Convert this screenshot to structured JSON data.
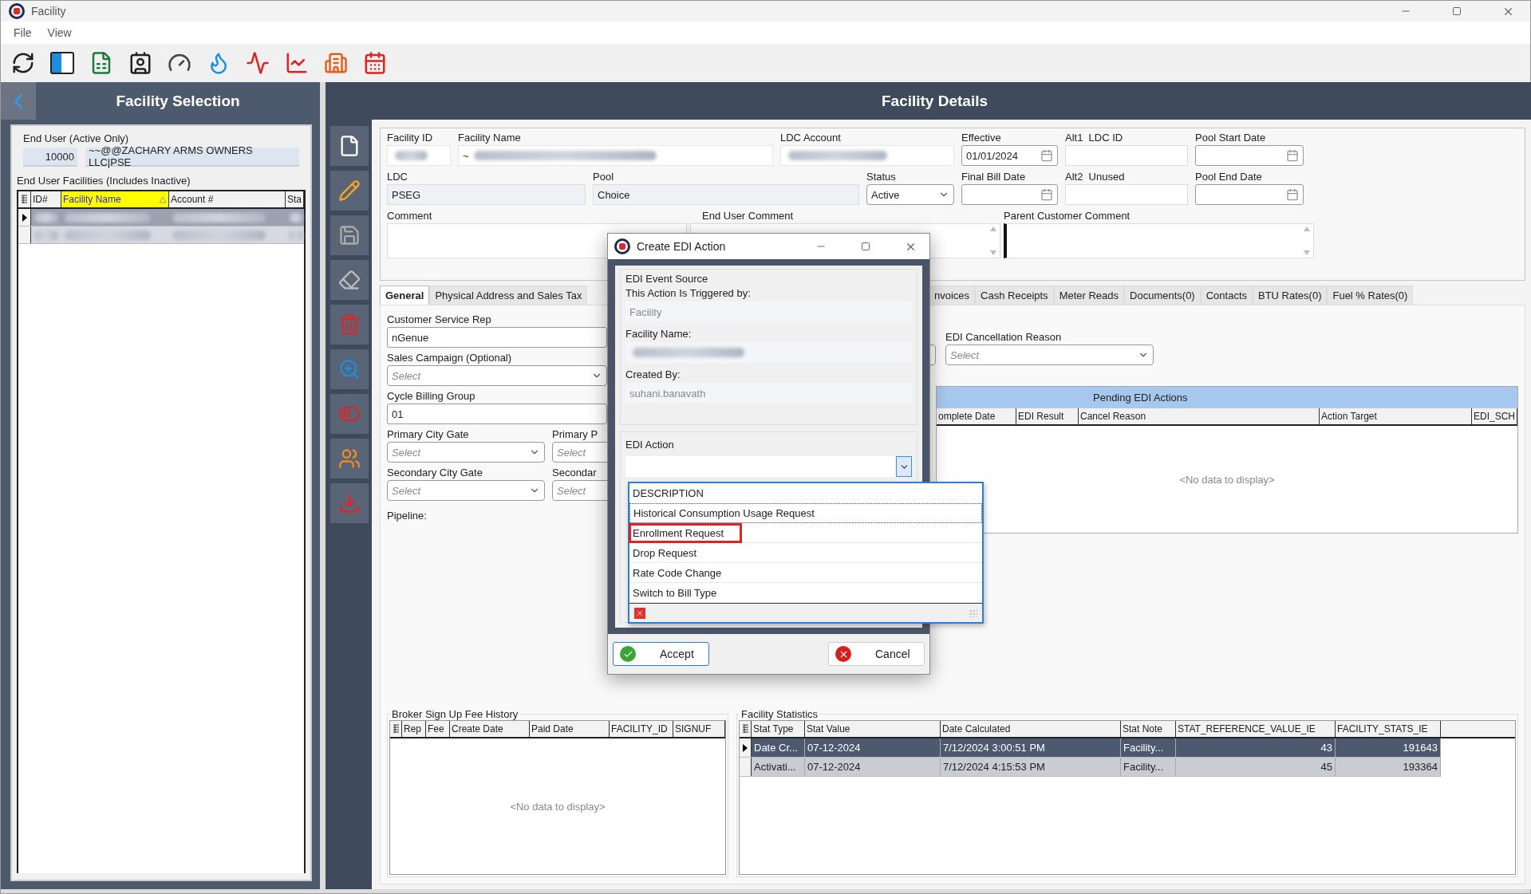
{
  "window": {
    "title": "Facility"
  },
  "menu": [
    "File",
    "View"
  ],
  "facility_selection": {
    "title": "Facility Selection",
    "end_user_label": "End User (Active Only)",
    "end_user_id": "10000",
    "end_user_name": "~~@@ZACHARY ARMS OWNERS LLC|PSE",
    "facilities_label": "End User Facilities (Includes Inactive)",
    "columns": [
      {
        "label": "ID#",
        "sorted": false
      },
      {
        "label": "Facility Name",
        "sorted": true
      },
      {
        "label": "Account #",
        "sorted": false
      },
      {
        "label": "Sta",
        "sorted": false
      }
    ],
    "rows": [
      {
        "current": true
      },
      {
        "current": false
      }
    ]
  },
  "facility_details": {
    "title": "Facility Details",
    "field_rows": [
      [
        {
          "label": "Facility ID",
          "kind": "redacted"
        },
        {
          "label": "Facility Name",
          "kind": "redacted",
          "value": "~"
        },
        {
          "label": "LDC Account",
          "kind": "redacted"
        },
        {
          "label": "Effective",
          "kind": "date",
          "value": "01/01/2024"
        },
        {
          "label": "Alt1  LDC ID",
          "kind": "text"
        },
        {
          "label": "Pool Start Date",
          "kind": "date"
        }
      ],
      [
        {
          "label": "LDC",
          "kind": "text",
          "value": "PSEG"
        },
        {
          "label": "Pool",
          "kind": "text",
          "value": "Choice"
        },
        {
          "label": "Status",
          "kind": "select",
          "value": "Active"
        },
        {
          "label": "Final Bill Date",
          "kind": "date"
        },
        {
          "label": "Alt2  Unused",
          "kind": "text"
        },
        {
          "label": "Pool End Date",
          "kind": "date"
        }
      ]
    ],
    "comments": [
      {
        "label": "Comment",
        "scrollbar": false
      },
      {
        "label": "End User Comment",
        "scrollbar": true
      },
      {
        "label": "Parent Customer Comment",
        "scrollbar": true
      }
    ],
    "tabs": [
      {
        "label": "General",
        "selected": true
      },
      {
        "label": "Physical Address and Sales Tax",
        "selected": false
      },
      {
        "label": "nvoices",
        "selected": false
      },
      {
        "label": "Cash Receipts",
        "selected": false
      },
      {
        "label": "Meter Reads",
        "selected": false
      },
      {
        "label": "Documents(0)",
        "selected": false
      },
      {
        "label": "Contacts",
        "selected": false
      },
      {
        "label": "BTU Rates(0)",
        "selected": false
      },
      {
        "label": "Fuel % Rates(0)",
        "selected": false
      }
    ],
    "general": {
      "fields": [
        {
          "label": "Customer Service Rep",
          "kind": "text",
          "value": "nGenue"
        },
        {
          "label": "Sales Campaign (Optional)",
          "kind": "select",
          "placeholder": "Select"
        },
        {
          "label": "Cycle Billing Group",
          "kind": "text",
          "value": "01"
        }
      ],
      "field_pairs": [
        [
          {
            "label": "Primary City Gate",
            "placeholder": "Select"
          },
          {
            "label": "Primary P",
            "placeholder": "Select"
          }
        ],
        [
          {
            "label": "Secondary City Gate",
            "placeholder": "Select"
          },
          {
            "label": "Secondar",
            "placeholder": "Select"
          }
        ]
      ],
      "pipeline_label": "Pipeline:",
      "cancellation": {
        "label": "EDI Cancellation Reason",
        "placeholder": "Select"
      },
      "pending": {
        "title": "Pending EDI Actions",
        "columns": [
          "omplete Date",
          "EDI Result",
          "Cancel Reason",
          "Action Target",
          "EDI_SCH"
        ],
        "empty": "<No data to display>"
      },
      "broker": {
        "title": "Broker Sign Up Fee History",
        "columns": [
          "Rep",
          "Fee",
          "Create Date",
          "Paid Date",
          "FACILITY_ID",
          "SIGNUF"
        ],
        "empty": "<No data to display>"
      },
      "statistics": {
        "title": "Facility Statistics",
        "columns": [
          "Stat Type",
          "Stat Value",
          "Date Calculated",
          "Stat Note",
          "STAT_REFERENCE_VALUE_IE",
          "FACILITY_STATS_IE"
        ],
        "rows": [
          {
            "selected": true,
            "cells": [
              "Date Cr...",
              "07-12-2024",
              "7/12/2024 3:00:51 PM",
              "Facility...",
              "43",
              "191643"
            ]
          },
          {
            "selected": false,
            "cells": [
              "Activati...",
              "07-12-2024",
              "7/12/2024 4:15:53 PM",
              "Facility...",
              "45",
              "193364"
            ]
          }
        ]
      }
    }
  },
  "dialog": {
    "title": "Create EDI Action",
    "source_group": "EDI Event Source",
    "fields": [
      {
        "label": "This Action Is Triggered by:",
        "kind": "text",
        "value": "Facility"
      },
      {
        "label": "Facility Name:",
        "kind": "redacted"
      },
      {
        "label": "Created By:",
        "kind": "text",
        "value": "suhani.banavath"
      }
    ],
    "action_group": "EDI Action",
    "expanded": true,
    "list_header": "DESCRIPTION",
    "items": [
      {
        "label": "Historical Consumption Usage Request",
        "focused": true,
        "highlighted": false
      },
      {
        "label": "Enrollment Request",
        "focused": false,
        "highlighted": true
      },
      {
        "label": "Drop Request",
        "focused": false,
        "highlighted": false
      },
      {
        "label": "Rate Code Change",
        "focused": false,
        "highlighted": false
      },
      {
        "label": "Switch to Bill Type",
        "focused": false,
        "highlighted": false
      }
    ],
    "buttons": [
      {
        "label": "Accept",
        "kind": "accept"
      },
      {
        "label": "Cancel",
        "kind": "cancel"
      }
    ]
  }
}
